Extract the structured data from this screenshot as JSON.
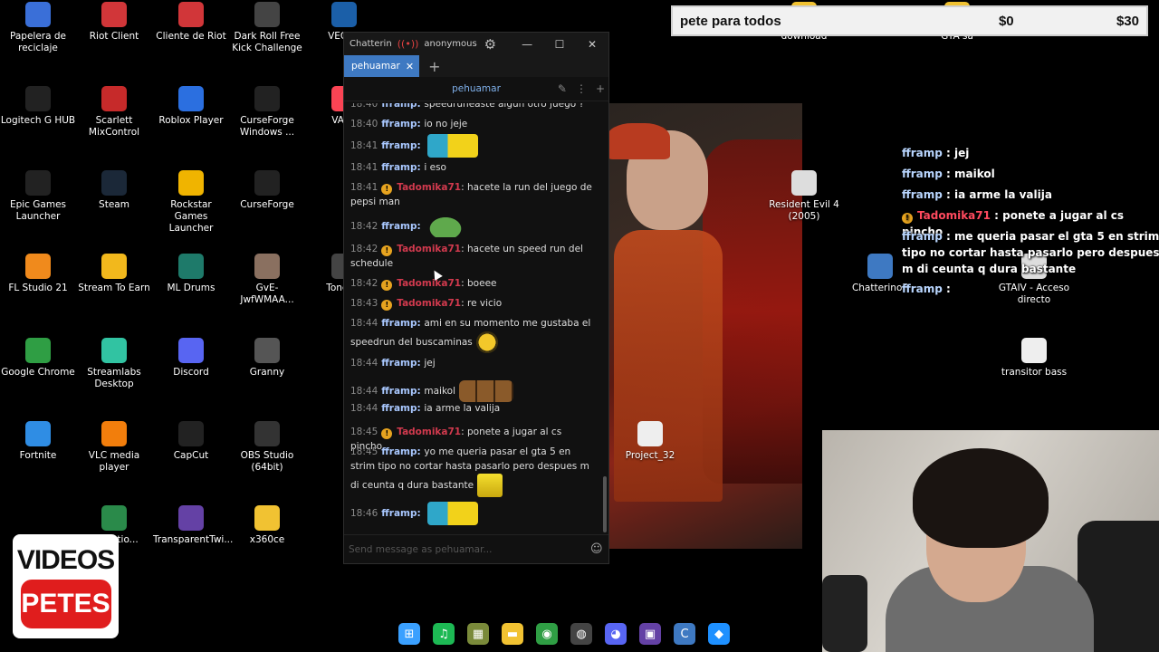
{
  "desktop_icons": [
    {
      "label": "Papelera de reciclaje",
      "icon": "recycle-bin-icon",
      "color": "#3a6fd8"
    },
    {
      "label": "Riot Client",
      "icon": "riot-icon",
      "color": "#d13639"
    },
    {
      "label": "Cliente de Riot",
      "icon": "riot-icon",
      "color": "#d13639"
    },
    {
      "label": "Dark Roll Free Kick Challenge",
      "icon": "ball-icon",
      "color": "#444444"
    },
    {
      "label": "VEGAS",
      "icon": "vegas-icon",
      "color": "#1b5fa8"
    },
    {
      "label": "Logitech G HUB",
      "icon": "logitech-icon",
      "color": "#222222"
    },
    {
      "label": "Scarlett MixControl",
      "icon": "scarlett-icon",
      "color": "#c62a2a"
    },
    {
      "label": "Roblox Player",
      "icon": "roblox-icon",
      "color": "#2b6fe0"
    },
    {
      "label": "CurseForge Windows ...",
      "icon": "curseforge-icon",
      "color": "#222222"
    },
    {
      "label": "VALO",
      "icon": "valorant-icon",
      "color": "#fa4454"
    },
    {
      "label": "Epic Games Launcher",
      "icon": "epic-icon",
      "color": "#222222"
    },
    {
      "label": "Steam",
      "icon": "steam-icon",
      "color": "#1b2838"
    },
    {
      "label": "Rockstar Games Launcher",
      "icon": "rockstar-icon",
      "color": "#f0b400"
    },
    {
      "label": "CurseForge",
      "icon": "curseforge-icon",
      "color": "#222222"
    },
    {
      "label": "FL Studio 21",
      "icon": "flstudio-icon",
      "color": "#f08a1c"
    },
    {
      "label": "Stream To Earn",
      "icon": "coin-icon",
      "color": "#f2b81c"
    },
    {
      "label": "ML Drums",
      "icon": "drums-icon",
      "color": "#1e7a6a"
    },
    {
      "label": "GvE-JwfWMAA...",
      "icon": "image-icon",
      "color": "#8a7060"
    },
    {
      "label": "ToneLib",
      "icon": "tonelib-icon",
      "color": "#444444"
    },
    {
      "label": "Google Chrome",
      "icon": "chrome-icon",
      "color": "#2f9e44"
    },
    {
      "label": "Streamlabs Desktop",
      "icon": "streamlabs-icon",
      "color": "#31c3a2"
    },
    {
      "label": "Discord",
      "icon": "discord-icon",
      "color": "#5865f2"
    },
    {
      "label": "Granny",
      "icon": "granny-icon",
      "color": "#555555"
    },
    {
      "label": "Fortnite",
      "icon": "fortnite-icon",
      "color": "#2f8de4"
    },
    {
      "label": "VLC media player",
      "icon": "vlc-icon",
      "color": "#f27e0c"
    },
    {
      "label": "CapCut",
      "icon": "capcut-icon",
      "color": "#222222"
    },
    {
      "label": "OBS Studio (64bit)",
      "icon": "obs-icon",
      "color": "#333333"
    },
    {
      "label": "ide ratio...",
      "icon": "app-icon",
      "color": "#2a8a4a"
    },
    {
      "label": "TransparentTwi...",
      "icon": "twitch-icon",
      "color": "#6441a5"
    },
    {
      "label": "x360ce",
      "icon": "folder-icon",
      "color": "#f1c232"
    },
    {
      "label": "download",
      "icon": "folder-icon",
      "color": "#f1c232"
    },
    {
      "label": "GTA sa",
      "icon": "folder-icon",
      "color": "#f1c232"
    },
    {
      "label": "Resident Evil 4 (2005)",
      "icon": "re4-icon",
      "color": "#dddddd"
    },
    {
      "label": "Chatterino7",
      "icon": "chatterino-icon",
      "color": "#3e79c2"
    },
    {
      "label": "GTAIV - Acceso directo",
      "icon": "gta-icon",
      "color": "#dddddd"
    },
    {
      "label": "transitor bass",
      "icon": "audio-file-icon",
      "color": "#eeeeee"
    },
    {
      "label": "Project_32",
      "icon": "audio-file-icon",
      "color": "#eeeeee"
    }
  ],
  "chatterino": {
    "app_title": "Chatterino",
    "live_icon": "broadcast-icon",
    "account": "anonymous",
    "tab": "pehuamar",
    "channel": "pehuamar",
    "placeholder": "Send message as pehuamar...",
    "messages": [
      {
        "time": "18:40",
        "user": "fframp",
        "text": "speedruneaste algun otro juego ?",
        "badge": false,
        "emote": ""
      },
      {
        "time": "18:40",
        "user": "fframp",
        "text": "io no jeje",
        "badge": false,
        "emote": ""
      },
      {
        "time": "18:41",
        "user": "fframp",
        "text": "",
        "badge": false,
        "emote": "wide"
      },
      {
        "time": "18:41",
        "user": "fframp",
        "text": "i eso",
        "badge": false,
        "emote": ""
      },
      {
        "time": "18:41",
        "user": "Tadomika71",
        "text": "hacete la run del juego de pepsi man",
        "badge": true,
        "emote": ""
      },
      {
        "time": "18:42",
        "user": "fframp",
        "text": "",
        "badge": false,
        "emote": "pepe"
      },
      {
        "time": "18:42",
        "user": "Tadomika71",
        "text": "hacete un speed run del schedule",
        "badge": true,
        "emote": ""
      },
      {
        "time": "18:42",
        "user": "Tadomika71",
        "text": "boeee",
        "badge": true,
        "emote": ""
      },
      {
        "time": "18:43",
        "user": "Tadomika71",
        "text": "re vicio",
        "badge": true,
        "emote": ""
      },
      {
        "time": "18:44",
        "user": "fframp",
        "text": "ami en su momento me gustaba el speedrun del buscaminas",
        "badge": false,
        "emote": "face"
      },
      {
        "time": "18:44",
        "user": "fframp",
        "text": "jej",
        "badge": false,
        "emote": ""
      },
      {
        "time": "18:44",
        "user": "fframp",
        "text": "maikol",
        "badge": false,
        "emote": "mins"
      },
      {
        "time": "18:44",
        "user": "fframp",
        "text": "ia arme la valija",
        "badge": false,
        "emote": ""
      },
      {
        "time": "18:45",
        "user": "Tadomika71",
        "text": "ponete a jugar al cs pincho",
        "badge": true,
        "emote": ""
      },
      {
        "time": "18:45",
        "user": "fframp",
        "text": "yo me queria pasar el gta 5 en strim tipo no cortar hasta pasarlo pero despues m di ceunta q dura bastante",
        "badge": false,
        "emote": "bob"
      },
      {
        "time": "18:46",
        "user": "fframp",
        "text": "",
        "badge": false,
        "emote": "wide"
      }
    ]
  },
  "goal_bar": {
    "title": "pete para todos",
    "current": "$0",
    "target": "$30"
  },
  "overlay_chat": [
    {
      "user": "fframp",
      "text": "jej",
      "badge": false
    },
    {
      "user": "fframp",
      "text": "maikol",
      "badge": false
    },
    {
      "user": "fframp",
      "text": "ia arme la valija",
      "badge": false
    },
    {
      "user": "Tadomika71",
      "text": "ponete a jugar al cs pincho",
      "badge": true
    },
    {
      "user": "fframp",
      "text": "me queria pasar el gta 5 en strim tipo no cortar hasta pasarlo pero despues m di ceunta q dura bastante",
      "badge": false
    },
    {
      "user": "fframp",
      "text": "",
      "badge": false
    }
  ],
  "logo": {
    "line1": "VIDEOS",
    "line2": "PETES"
  },
  "taskbar": [
    {
      "name": "windows-start-icon",
      "color": "#3aa0ff",
      "glyph": "⊞"
    },
    {
      "name": "spotify-icon",
      "color": "#1db954",
      "glyph": "♫"
    },
    {
      "name": "game-icon",
      "color": "#7a8a3a",
      "glyph": "▦"
    },
    {
      "name": "file-explorer-icon",
      "color": "#f1c232",
      "glyph": "▬"
    },
    {
      "name": "chrome-icon",
      "color": "#2f9e44",
      "glyph": "◉"
    },
    {
      "name": "obs-icon",
      "color": "#444444",
      "glyph": "◍"
    },
    {
      "name": "discord-icon",
      "color": "#5865f2",
      "glyph": "◕"
    },
    {
      "name": "twitch-icon",
      "color": "#6441a5",
      "glyph": "▣"
    },
    {
      "name": "chatterino-icon",
      "color": "#3e79c2",
      "glyph": "C"
    },
    {
      "name": "app-icon",
      "color": "#1e90ff",
      "glyph": "◆"
    }
  ]
}
